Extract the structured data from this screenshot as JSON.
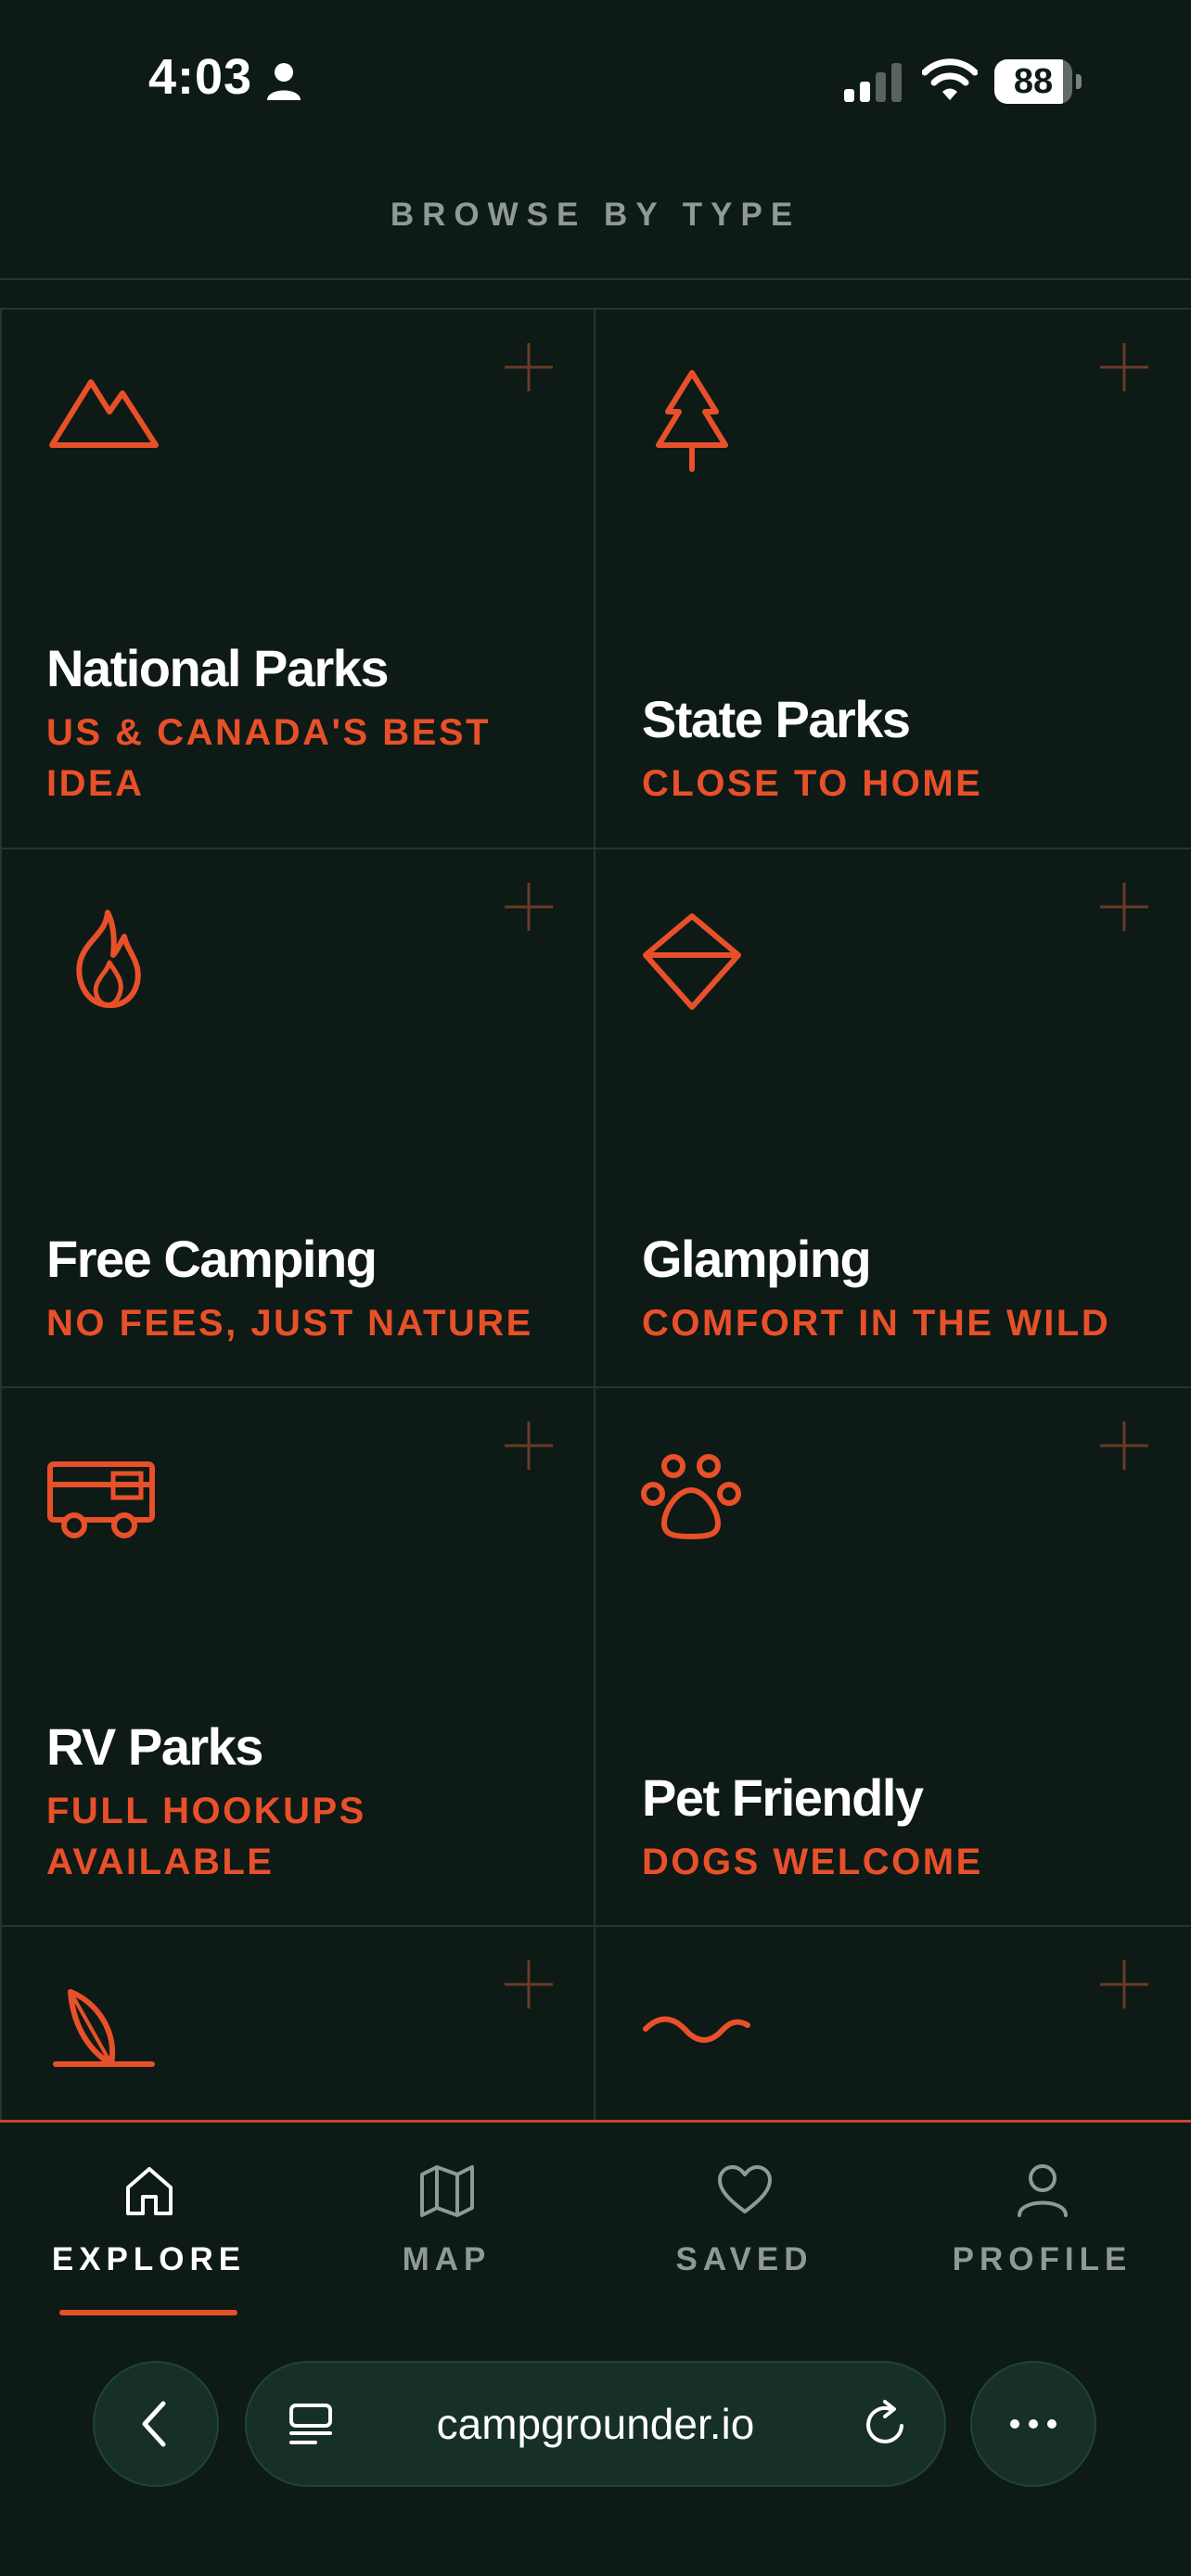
{
  "status_bar": {
    "time": "4:03",
    "battery": "88",
    "battery_level": 0.88
  },
  "header": {
    "title": "BROWSE BY TYPE"
  },
  "categories": [
    {
      "name": "National Parks",
      "tagline": "US & CANADA'S BEST IDEA",
      "icon": "mountain-icon"
    },
    {
      "name": "State Parks",
      "tagline": "CLOSE TO HOME",
      "icon": "pine-tree-icon"
    },
    {
      "name": "Free Camping",
      "tagline": "NO FEES, JUST NATURE",
      "icon": "flame-icon"
    },
    {
      "name": "Glamping",
      "tagline": "COMFORT IN THE WILD",
      "icon": "diamond-icon"
    },
    {
      "name": "RV Parks",
      "tagline": "FULL HOOKUPS AVAILABLE",
      "icon": "rv-icon"
    },
    {
      "name": "Pet Friendly",
      "tagline": "DOGS WELCOME",
      "icon": "paw-icon"
    },
    {
      "name": "",
      "tagline": "",
      "icon": "beach-umbrella-icon"
    },
    {
      "name": "",
      "tagline": "",
      "icon": "wave-icon"
    }
  ],
  "nav": {
    "items": [
      {
        "label": "EXPLORE",
        "icon": "home-icon",
        "active": true
      },
      {
        "label": "MAP",
        "icon": "map-icon",
        "active": false
      },
      {
        "label": "SAVED",
        "icon": "heart-icon",
        "active": false
      },
      {
        "label": "PROFILE",
        "icon": "person-icon",
        "active": false
      }
    ]
  },
  "browser": {
    "url": "campgrounder.io"
  },
  "colors": {
    "background": "#0e1a15",
    "accent": "#e8502a",
    "muted": "#8e9a93",
    "grid_line": "#26352d"
  }
}
